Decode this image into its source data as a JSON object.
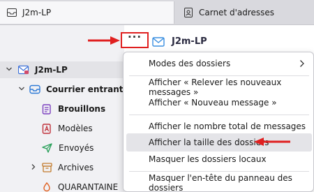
{
  "tabs": [
    {
      "label": "J2m-LP",
      "icon": "mail-window-icon"
    },
    {
      "label": "Carnet d'adresses",
      "icon": "address-book-icon"
    }
  ],
  "folder_pane": {
    "more_button_label": "···",
    "account": "J2m-LP",
    "folders": [
      {
        "label": "Courrier entrant",
        "icon": "inbox-icon"
      },
      {
        "label": "Brouillons",
        "icon": "drafts-icon"
      },
      {
        "label": "Modèles",
        "icon": "templates-icon"
      },
      {
        "label": "Envoyés",
        "icon": "sent-icon"
      },
      {
        "label": "Archives",
        "icon": "archives-icon"
      },
      {
        "label": "QUARANTAINE",
        "icon": "quarantine-icon"
      }
    ]
  },
  "right_panel": {
    "account": "J2m-LP"
  },
  "menu": {
    "items": [
      {
        "label": "Modes des dossiers"
      },
      {
        "label": "Afficher « Relever les nouveaux messages »"
      },
      {
        "label": "Afficher « Nouveau message »"
      },
      {
        "label": "Afficher le nombre total de messages"
      },
      {
        "label": "Afficher la taille des dossiers"
      },
      {
        "label": "Masquer les dossiers locaux"
      },
      {
        "label": "Masquer l'en-tête du panneau des dossiers"
      }
    ]
  },
  "colors": {
    "accent": "#2f7bd6",
    "annotation": "#e02020",
    "hover": "#e4e4e8"
  }
}
